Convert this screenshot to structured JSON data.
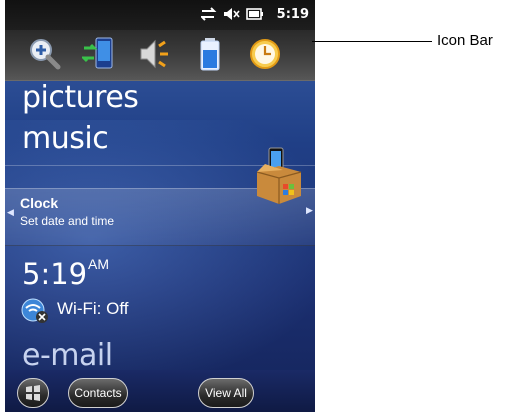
{
  "status_bar": {
    "time": "5:19",
    "icons": [
      "data-sync-icon",
      "volume-muted-icon",
      "battery-icon"
    ]
  },
  "icon_bar": {
    "icons": [
      "zoom-icon",
      "connections-icon",
      "volume-icon",
      "battery-icon",
      "clock-icon"
    ]
  },
  "tiles": {
    "pictures": "pictures",
    "music": "music",
    "email": "e-mail"
  },
  "clock_tile": {
    "title": "Clock",
    "subtitle": "Set date and time"
  },
  "time_display": {
    "time": "5:19",
    "ampm": "AM"
  },
  "wifi": {
    "status": "Wi-Fi: Off"
  },
  "bottom_bar": {
    "contacts": "Contacts",
    "view_all": "View All"
  },
  "callout": {
    "label": "Icon Bar"
  }
}
